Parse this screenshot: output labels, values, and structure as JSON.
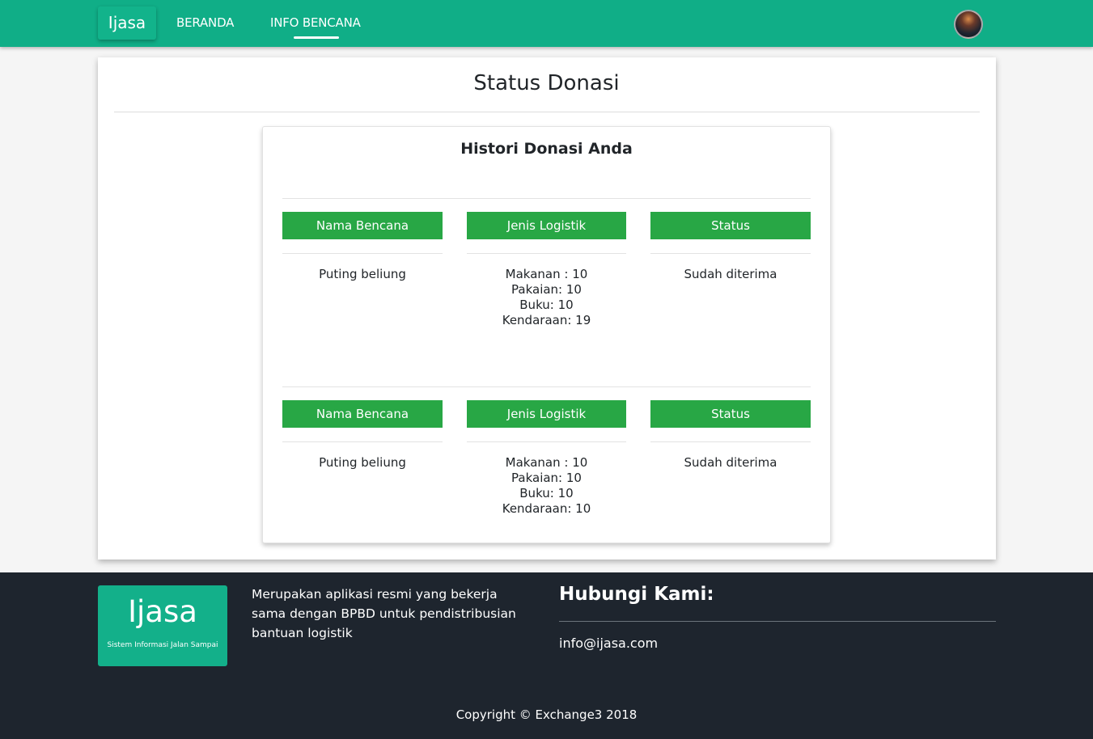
{
  "navbar": {
    "brand": "Ijasa",
    "links": [
      "BERANDA",
      "INFO BENCANA"
    ],
    "active_link": "INFO BENCANA",
    "color": "#10ae87"
  },
  "main": {
    "title": "Status Donasi",
    "history": {
      "title": "Histori Donasi Anda",
      "headers": [
        "Nama Bencana",
        "Jenis Logistik",
        "Status"
      ],
      "header_color": "#28a745",
      "rows": [
        {
          "nama_bencana": "Puting beliung",
          "logistik": [
            "Makanan : 10",
            "Pakaian: 10",
            "Buku: 10",
            "Kendaraan: 19"
          ],
          "status": "Sudah diterima"
        },
        {
          "nama_bencana": "Puting beliung",
          "logistik": [
            "Makanan : 10",
            "Pakaian: 10",
            "Buku: 10",
            "Kendaraan: 10"
          ],
          "status": "Sudah diterima"
        }
      ]
    }
  },
  "footer": {
    "logo_text": "Ijasa",
    "logo_subtitle": "Sistem Informasi Jalan Sampai",
    "about": "Merupakan aplikasi resmi yang bekerja sama dengan BPBD untuk pendistribusian bantuan logistik",
    "contact_title": "Hubungi Kami:",
    "email": "info@ijasa.com",
    "copyright": "Copyright © Exchange3 2018",
    "background": "#1e252e"
  }
}
